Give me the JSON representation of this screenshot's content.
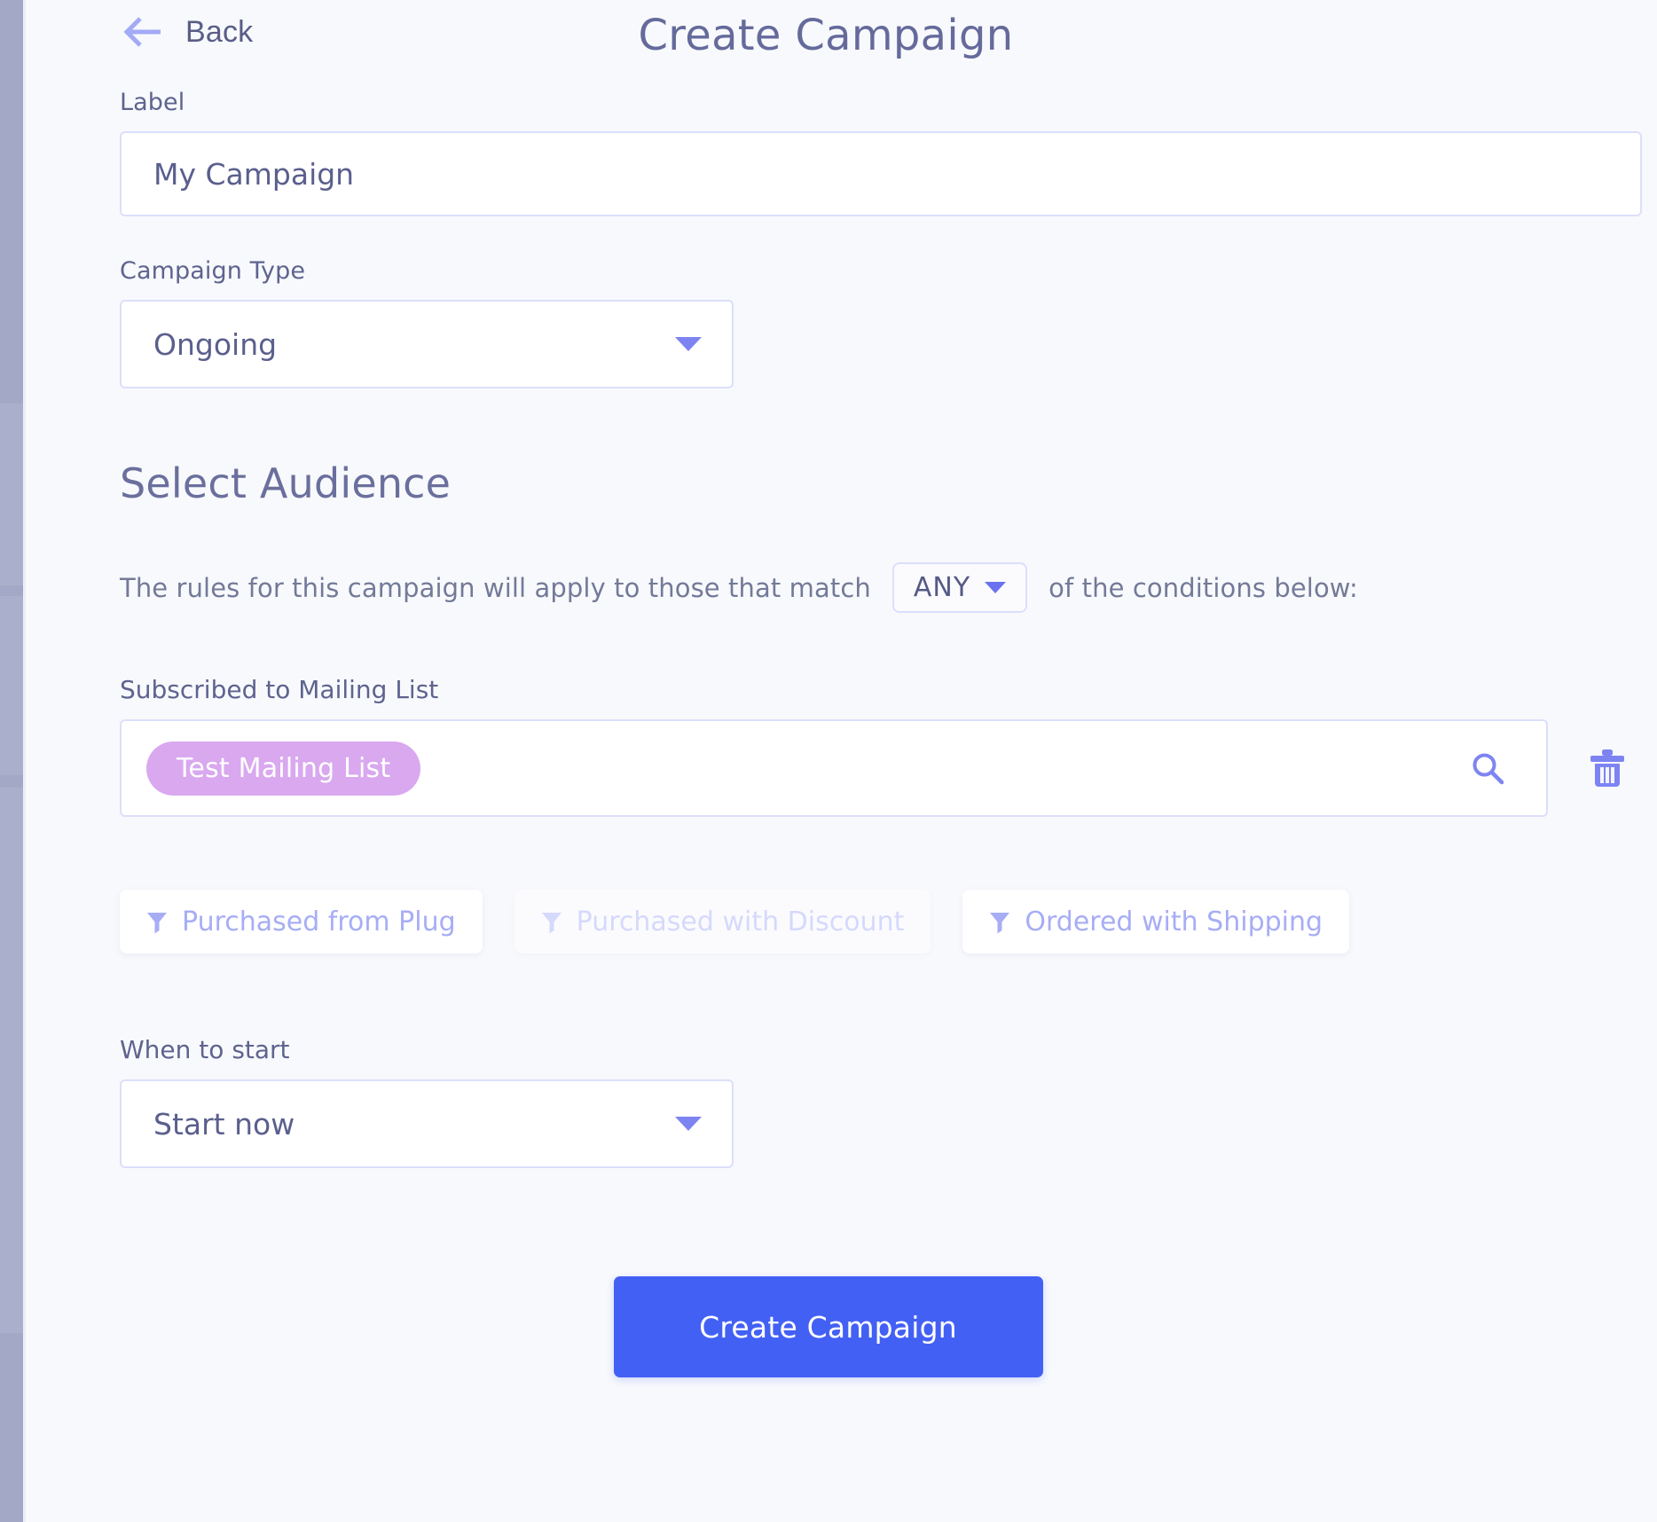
{
  "header": {
    "back_label": "Back",
    "back_icon": "arrow-left-icon",
    "title": "Create Campaign"
  },
  "form": {
    "label_field": {
      "label": "Label",
      "value": "My Campaign",
      "placeholder": "My Campaign"
    },
    "campaign_type": {
      "label": "Campaign Type",
      "value": "Ongoing",
      "caret_icon": "chevron-down-icon"
    }
  },
  "audience": {
    "title": "Select Audience",
    "rule_prefix": "The rules for this campaign will apply to those that match",
    "match_mode": "ANY",
    "rule_suffix": "of the conditions below:",
    "mailing_list": {
      "label": "Subscribed to Mailing List",
      "chips": [
        "Test Mailing List"
      ],
      "search_icon": "search-icon",
      "delete_icon": "trash-icon"
    },
    "filters": [
      {
        "label": "Purchased from Plug",
        "icon": "filter-funnel-icon",
        "state": "enabled"
      },
      {
        "label": "Purchased with Discount",
        "icon": "filter-funnel-icon",
        "state": "faded"
      },
      {
        "label": "Ordered with Shipping",
        "icon": "filter-funnel-icon",
        "state": "enabled"
      }
    ]
  },
  "schedule": {
    "label": "When to start",
    "value": "Start now",
    "caret_icon": "chevron-down-icon"
  },
  "submit": {
    "label": "Create Campaign"
  },
  "colors": {
    "page_background": "#f8f9fc",
    "accent_blue": "#4360f5",
    "periwinkle": "#7d84f2",
    "chip_purple": "#d9a8ef",
    "border": "#dcdffa",
    "text": "#5a5f8d",
    "sidebar_strip": "#a3a8c6"
  }
}
